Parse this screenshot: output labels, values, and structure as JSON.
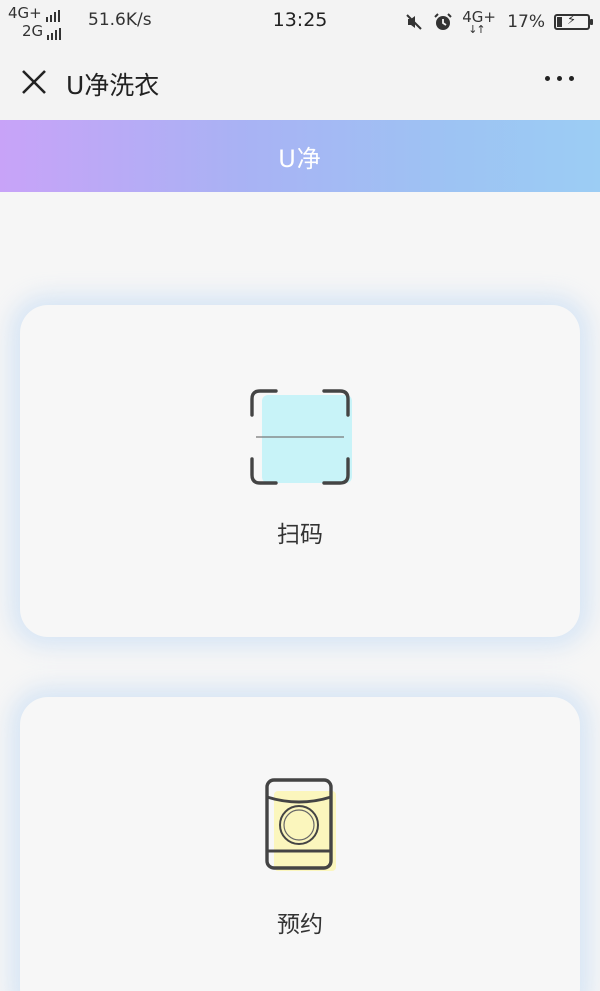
{
  "status_bar": {
    "network_primary": "4G+",
    "network_secondary": "2G",
    "speed": "51.6K/s",
    "time": "13:25",
    "network_right": "4G+",
    "battery": "17%"
  },
  "title_bar": {
    "title": "U净洗衣"
  },
  "header": {
    "title": "U净"
  },
  "cards": {
    "scan": {
      "label": "扫码",
      "icon": "scan-qr-icon",
      "icon_fill": "#c8f3f8"
    },
    "book": {
      "label": "预约",
      "icon": "washing-machine-icon",
      "icon_fill": "#fbf6bd"
    }
  },
  "colors": {
    "gradient_start": "#c8a3f8",
    "gradient_end": "#9ccdf4",
    "card_glow": "#b4d2f5",
    "page_background": "#f6f6f6"
  }
}
